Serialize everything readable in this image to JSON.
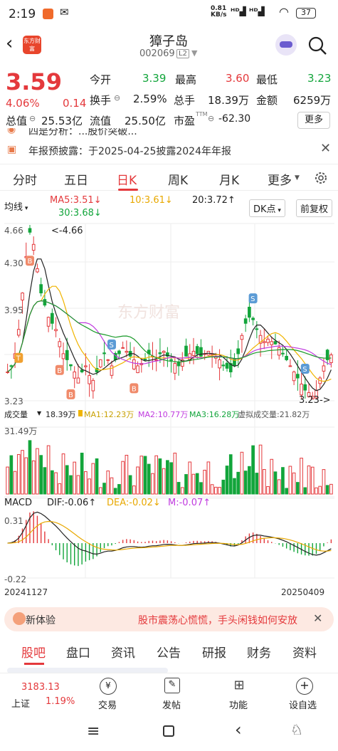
{
  "status_bar": {
    "time": "2:19",
    "net_speed_value": "0.81",
    "net_speed_unit": "KB/s",
    "battery": "37"
  },
  "header": {
    "app_logo_text": "东方财富",
    "title": "獐子岛",
    "code": "002069",
    "level": "L2"
  },
  "quote": {
    "price": "3.59",
    "change_pct": "4.06%",
    "change": "0.14",
    "fields": {
      "open_label": "今开",
      "open_value": "3.39",
      "high_label": "最高",
      "high_value": "3.60",
      "low_label": "最低",
      "low_value": "3.23",
      "turnover_label": "换手",
      "turnover_value": "2.59%",
      "volume_label": "总手",
      "volume_value": "18.39万",
      "amount_label": "金额",
      "amount_value": "6259万",
      "total_cap_label": "总值",
      "total_cap_value": "25.53亿",
      "float_cap_label": "流值",
      "float_cap_value": "25.50亿",
      "pe_label": "市盈",
      "pe_sup": "TTM",
      "pe_value": "-62.30",
      "more_button": "更多"
    }
  },
  "notices": {
    "line1": "四是分析：...股价突破...",
    "line2": "年报预披露：于2025-04-25披露2024年年报"
  },
  "period_tabs": [
    "分时",
    "五日",
    "日K",
    "周K",
    "月K",
    "更多"
  ],
  "chart_toolbar": {
    "ma_select": "均线",
    "ma5": "MA5:3.51↓",
    "ma10": "10:3.61↓",
    "ma20": "20:3.72↑",
    "ma30": "30:3.68↓",
    "dk_button": "DK点",
    "adjust_button": "前复权"
  },
  "kline": {
    "high_label": "4.66",
    "high_annot": "<-4.66",
    "y_ticks": [
      "4.66",
      "4.30",
      "3.95",
      "3.23"
    ],
    "low_annot": "3.23->",
    "low_label": "3.23",
    "watermark": "东方财富"
  },
  "volume": {
    "label": "成交量",
    "total": "18.39万",
    "ma1": "MA1:12.23万",
    "ma2": "MA2:10.77万",
    "ma3": "MA3:16.28万",
    "virtual": "虚拟成交量:21.82万",
    "max_label": "31.49万"
  },
  "macd": {
    "label": "MACD",
    "dif": "DIF:-0.06↑",
    "dea": "DEA:-0.02↓",
    "m": "M:-0.07↑",
    "top_label": "0.31",
    "bottom_label": "-0.22",
    "start_date": "20241127",
    "end_date": "20250409"
  },
  "banner": {
    "left_text": "新体验",
    "right_text": "股市震荡心慌慌，手头闲钱如何安放"
  },
  "bottom_tabs": [
    "股吧",
    "盘口",
    "资讯",
    "公告",
    "研报",
    "财务",
    "资料"
  ],
  "dock": {
    "index_value": "3183.13",
    "index_name": "上证",
    "index_change": "1.19%",
    "trade": "交易",
    "post": "发帖",
    "function": "功能",
    "watchlist": "设自选"
  },
  "colors": {
    "up": "#e4393c",
    "down": "#12a53b",
    "ma5": "#222222",
    "ma10": "#f0b400",
    "ma20": "#c03adf",
    "ma30": "#1a9a2a",
    "accent_bg": "#fde9e2"
  }
}
